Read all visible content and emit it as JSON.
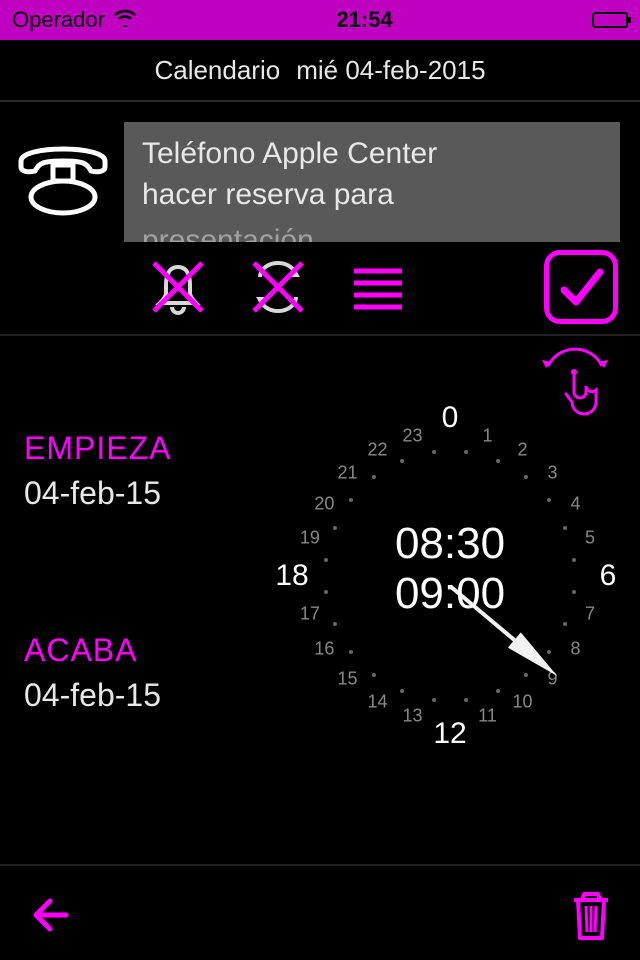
{
  "statusbar": {
    "carrier": "Operador",
    "time": "21:54"
  },
  "header": {
    "label": "Calendario",
    "date": "mié 04-feb-2015"
  },
  "event": {
    "title": "Teléfono Apple Center",
    "line2": "hacer reserva para",
    "line3_partial": "presentación"
  },
  "actions": {
    "alarm_off_icon": "alarm-off-icon",
    "repeat_off_icon": "repeat-off-icon",
    "list_icon": "list-icon",
    "confirm_icon": "check-icon"
  },
  "schedule": {
    "starts_label": "EMPIEZA",
    "ends_label": "ACABA",
    "starts_date": "04-feb-15",
    "ends_date": "04-feb-15",
    "start_time": "08:30",
    "end_time": "09:00",
    "dial_hours": [
      "0",
      "1",
      "2",
      "3",
      "4",
      "5",
      "6",
      "7",
      "8",
      "9",
      "10",
      "11",
      "12",
      "13",
      "14",
      "15",
      "16",
      "17",
      "18",
      "19",
      "20",
      "21",
      "22",
      "23"
    ],
    "major_hours": [
      0,
      6,
      12,
      18
    ]
  },
  "colors": {
    "accent": "#ff00ff",
    "statusbar": "#c000c0"
  }
}
